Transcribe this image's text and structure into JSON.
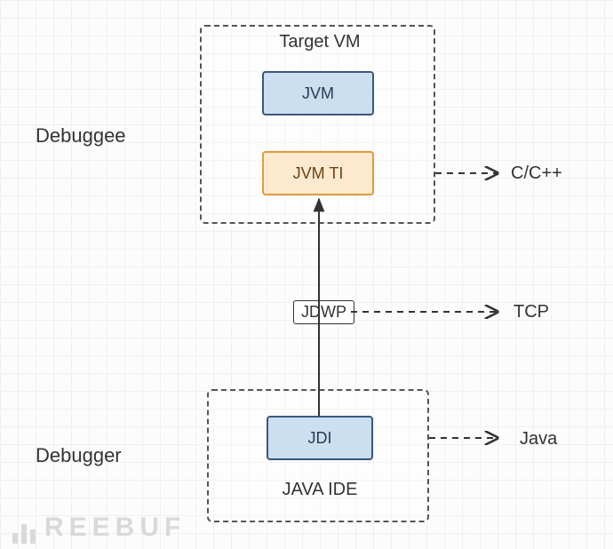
{
  "diagram": {
    "debuggee_label": "Debuggee",
    "debugger_label": "Debugger",
    "target_vm": {
      "title": "Target VM",
      "jvm": "JVM",
      "jvmti": "JVM TI"
    },
    "jdwp": "JDWP",
    "java_ide": {
      "title": "JAVA IDE",
      "jdi": "JDI"
    },
    "arrows": {
      "cpp": "C/C++",
      "tcp": "TCP",
      "java": "Java"
    }
  },
  "watermark": "REEBUF"
}
